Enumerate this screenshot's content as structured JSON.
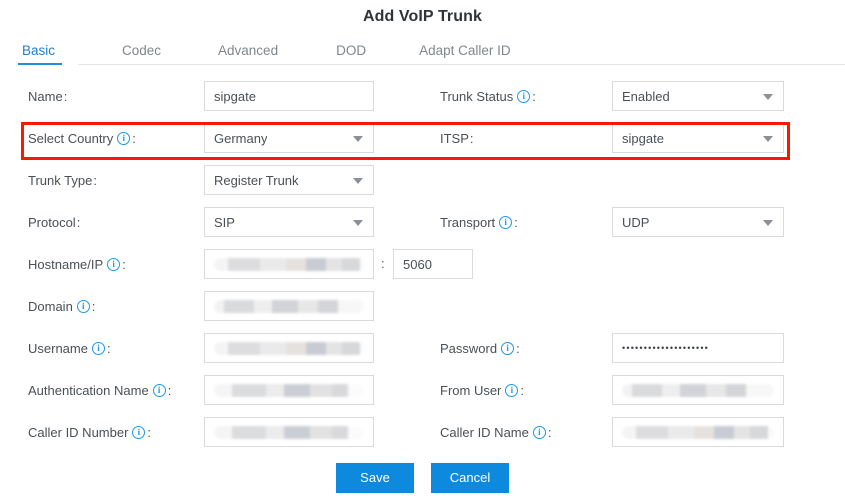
{
  "dialog": {
    "title": "Add VoIP Trunk"
  },
  "tabs": [
    {
      "label": "Basic",
      "active": true
    },
    {
      "label": "Codec",
      "active": false
    },
    {
      "label": "Advanced",
      "active": false
    },
    {
      "label": "DOD",
      "active": false
    },
    {
      "label": "Adapt Caller ID",
      "active": false
    }
  ],
  "fields": {
    "name": {
      "label": "Name",
      "value": "sipgate",
      "info": false
    },
    "trunk_status": {
      "label": "Trunk Status",
      "value": "Enabled",
      "info": true
    },
    "select_country": {
      "label": "Select Country",
      "value": "Germany",
      "info": true
    },
    "itsp": {
      "label": "ITSP",
      "value": "sipgate",
      "info": false
    },
    "trunk_type": {
      "label": "Trunk Type",
      "value": "Register Trunk",
      "info": false
    },
    "protocol": {
      "label": "Protocol",
      "value": "SIP",
      "info": false
    },
    "transport": {
      "label": "Transport",
      "value": "UDP",
      "info": true
    },
    "hostname_ip": {
      "label": "Hostname/IP",
      "value": "",
      "info": true
    },
    "port": {
      "value": "5060",
      "separator": ":"
    },
    "domain": {
      "label": "Domain",
      "value": "",
      "info": true
    },
    "username": {
      "label": "Username",
      "value": "",
      "info": true
    },
    "password": {
      "label": "Password",
      "value": "••••••••••••••••••••",
      "info": true
    },
    "auth_name": {
      "label": "Authentication Name",
      "value": "",
      "info": true
    },
    "from_user": {
      "label": "From User",
      "value": "",
      "info": true
    },
    "caller_id_number": {
      "label": "Caller ID Number",
      "value": "",
      "info": true
    },
    "caller_id_name": {
      "label": "Caller ID Name",
      "value": "",
      "info": true
    }
  },
  "buttons": {
    "save": "Save",
    "cancel": "Cancel"
  },
  "colors": {
    "accent": "#0d8add",
    "tab_active": "#1b8fe0",
    "info_icon": "#1b9ae8",
    "highlight": "#fb1800"
  },
  "icons": {
    "info": "i",
    "dropdown": "chevron-down"
  }
}
